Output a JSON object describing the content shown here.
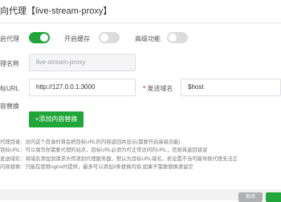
{
  "dialog": {
    "title": "向代理【live-stream-proxy】"
  },
  "switches": {
    "enable_label": "启代理",
    "enable_on": true,
    "cache_label": "开启缓存",
    "cache_on": false,
    "advanced_label": "高级功能",
    "advanced_on": false
  },
  "fields": {
    "name_label": "理名称",
    "name_value": "live-stream-proxy",
    "url_label": "标URL",
    "url_value": "http://127.0.0.1:3000",
    "domain_required_mark": "*",
    "domain_label": "发送域名",
    "domain_value": "$host",
    "replace_label": "容替换"
  },
  "buttons": {
    "add_replace": "+添加内容替换",
    "cancel": "取消"
  },
  "notes": [
    "代理目录：访问这个目录时将会把目标URL的内容返回并显示(需要开启高级功能)",
    "目标URL：可以填写你需要代理的站点，目标URL必须为可正常访问的URL，否则将返回错误",
    "发送域名：将域名添加到请求头传递到代理服务器，默认为目标URL域名，若设置不当可能导致代理无法正",
    "内容替换：只能在使用nginx时提供，最多可以添加3条替换内容,如果不需要替换请留空"
  ],
  "colors": {
    "primary": "#20a53a",
    "required": "#ef0808"
  }
}
